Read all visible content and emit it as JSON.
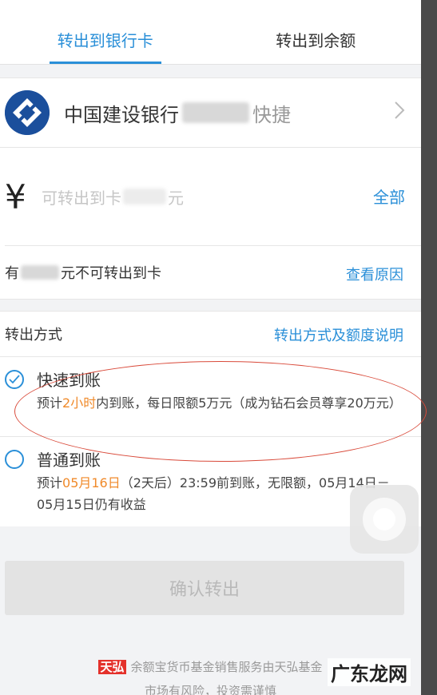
{
  "tabs": [
    {
      "label": "转出到银行卡",
      "active": true
    },
    {
      "label": "转出到余额",
      "active": false
    }
  ],
  "bank": {
    "name": "中国建设银行",
    "tag": "快捷",
    "logo_icon": "ccb-bank-logo-icon",
    "chevron_icon": "chevron-right-icon"
  },
  "amount": {
    "currency_symbol": "¥",
    "placeholder_prefix": "可转出到卡",
    "placeholder_suffix": "元",
    "all_button": "全部"
  },
  "notice": {
    "prefix": "有",
    "suffix": "元不可转出到卡",
    "link": "查看原因"
  },
  "method": {
    "label": "转出方式",
    "link": "转出方式及额度说明"
  },
  "options": [
    {
      "title": "快速到账",
      "checked": true,
      "desc_pre": "预计",
      "desc_highlight": "2小时",
      "desc_post": "内到账，每日限额5万元（成为钻石会员尊享20万元）"
    },
    {
      "title": "普通到账",
      "checked": false,
      "desc_pre": "预计",
      "desc_highlight": "05月16日",
      "desc_post": "（2天后）23:59前到账，无限额，05月14日－05月15日仍有收益"
    }
  ],
  "confirm_button": "确认转出",
  "footer": {
    "brand": "天弘",
    "line1": "余额宝货币基金销售服务由天弘基金",
    "line2": "市场有风险，投资需谨慎"
  },
  "watermark": "广东龙网",
  "colors": {
    "accent": "#2a8fd8",
    "highlight": "#f08a2a",
    "annotation": "#d94a3a",
    "bank_blue": "#1b4f9c"
  }
}
